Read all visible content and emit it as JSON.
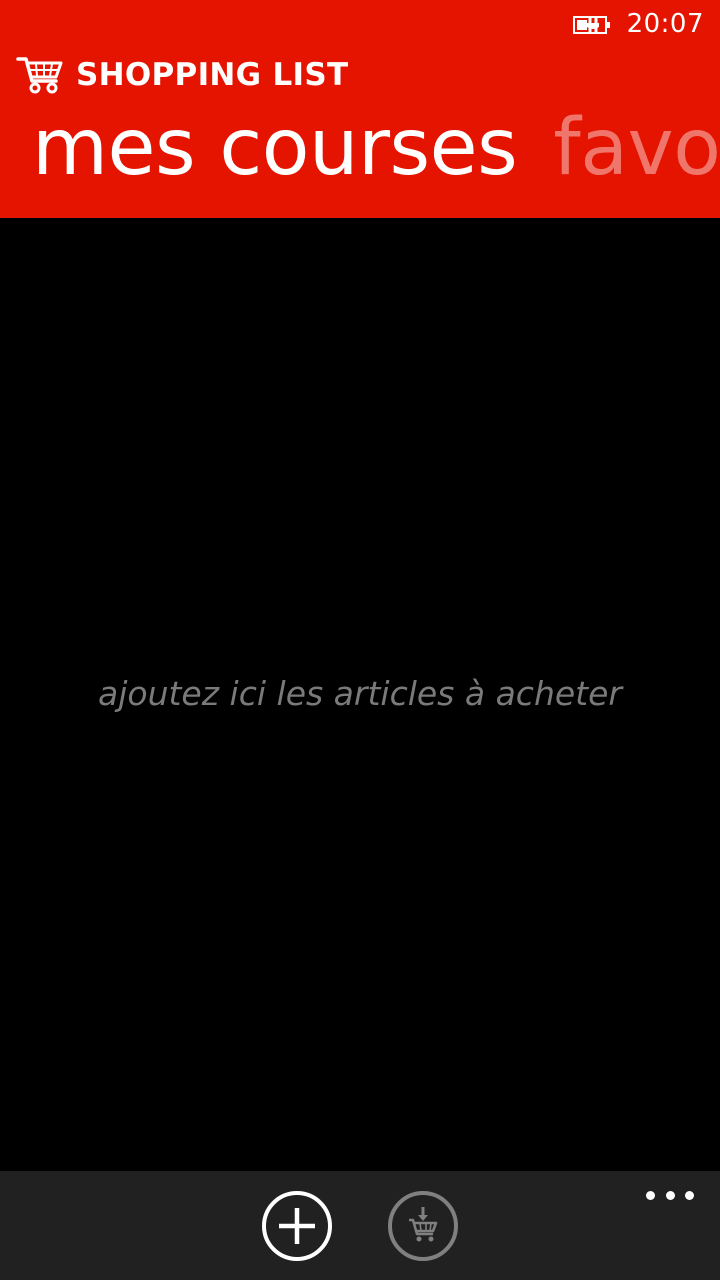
{
  "status_bar": {
    "time": "20:07",
    "battery_icon": "battery-charging-icon"
  },
  "header": {
    "background_color": "#e51400",
    "app_icon": "shopping-cart-icon",
    "app_title": "SHOPPING LIST"
  },
  "pivot": {
    "items": [
      {
        "label": "mes courses",
        "active": true
      },
      {
        "label": "favoris",
        "active": false
      }
    ]
  },
  "content": {
    "empty_hint": "ajoutez ici les articles à acheter"
  },
  "app_bar": {
    "background_color": "#212121",
    "buttons": [
      {
        "icon": "add-icon",
        "enabled": true
      },
      {
        "icon": "cart-download-icon",
        "enabled": false
      }
    ],
    "more_icon": "more-dots-icon"
  }
}
